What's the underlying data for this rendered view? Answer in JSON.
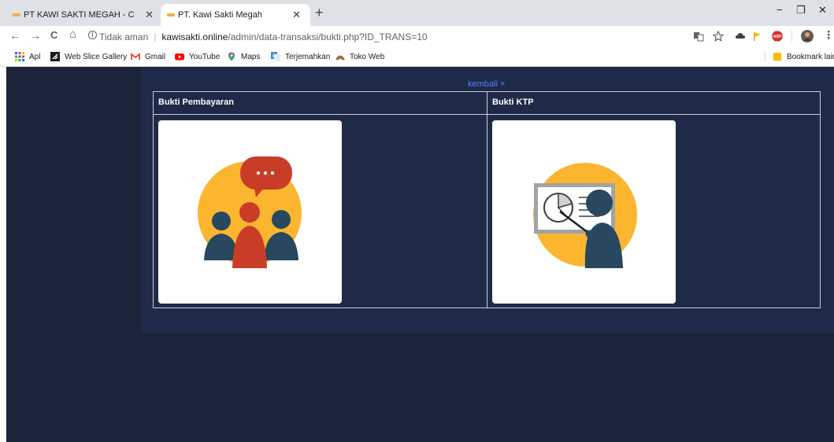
{
  "browser": {
    "tabs": [
      {
        "title": "PT KAWI SAKTI MEGAH - Constru",
        "active": false
      },
      {
        "title": "PT. Kawi Sakti Megah",
        "active": true
      }
    ],
    "new_tab": "+",
    "window_controls": [
      "−",
      "❐",
      "✕"
    ],
    "nav": {
      "back": "←",
      "forward": "→",
      "reload": "C",
      "home": "⌂"
    },
    "address": {
      "security_label": "Tidak aman",
      "host": "kawisakti.online",
      "path": "/admin/data-transaksi/bukti.php?ID_TRANS=10"
    },
    "bookmarks": [
      {
        "label": "Apl",
        "icon": "apps-grid-icon"
      },
      {
        "label": "Web Slice Gallery",
        "icon": "web-slice-icon"
      },
      {
        "label": "Gmail",
        "icon": "gmail-icon"
      },
      {
        "label": "YouTube",
        "icon": "youtube-icon"
      },
      {
        "label": "Maps",
        "icon": "maps-icon"
      },
      {
        "label": "Terjemahkan",
        "icon": "translate-icon"
      },
      {
        "label": "Toko Web",
        "icon": "web-store-icon"
      }
    ],
    "other_bookmarks": "Bookmark lain"
  },
  "page": {
    "back_link": "kembali ×",
    "columns": [
      {
        "header": "Bukti Pembayaran",
        "image": "group-discussion-illustration"
      },
      {
        "header": "Bukti KTP",
        "image": "presentation-illustration"
      }
    ]
  },
  "colors": {
    "page_bg": "#1b2438",
    "panel_bg": "#1e2a47",
    "link": "#4f86f7",
    "illustration_yellow": "#fbb52f",
    "illustration_red": "#c93c28",
    "illustration_navy": "#27485e"
  }
}
